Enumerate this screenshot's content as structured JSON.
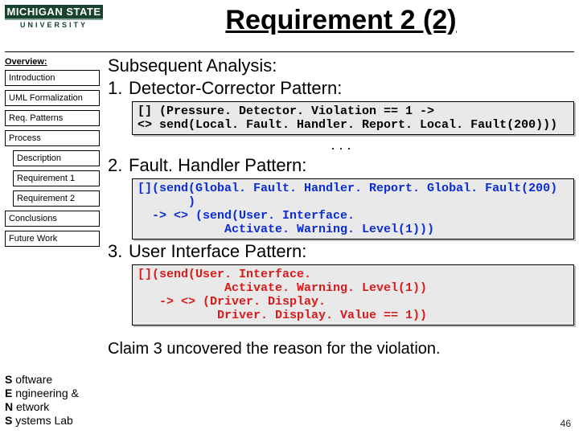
{
  "logo": {
    "top": "MICHIGAN STATE",
    "bottom": "UNIVERSITY"
  },
  "title": "Requirement 2 (2)",
  "sidebar": {
    "heading": "Overview:",
    "items": [
      "Introduction",
      "UML Formalization",
      "Req. Patterns",
      "Process"
    ],
    "sub_items": [
      "Description",
      "Requirement 1",
      "Requirement 2"
    ],
    "items2": [
      "Conclusions",
      "Future Work"
    ]
  },
  "lab_lines": [
    "S oftware",
    "E ngineering &",
    "N etwork",
    "S ystems Lab"
  ],
  "content": {
    "lead": "Subsequent Analysis:",
    "p1": {
      "num": "1.",
      "label": "Detector-Corrector Pattern:",
      "code": "[] (Pressure. Detector. Violation == 1 ->\n<> send(Local. Fault. Handler. Report. Local. Fault(200)))"
    },
    "dots": ". . .",
    "p2": {
      "num": "2.",
      "label": "Fault. Handler Pattern:",
      "code": "[](send(Global. Fault. Handler. Report. Global. Fault(200)\n       )\n  -> <> (send(User. Interface.\n            Activate. Warning. Level(1)))"
    },
    "p3": {
      "num": "3.",
      "label": "User Interface Pattern:",
      "code": "[](send(User. Interface.\n            Activate. Warning. Level(1))\n   -> <> (Driver. Display.\n           Driver. Display. Value == 1))"
    },
    "claim": "Claim 3 uncovered the reason for the violation."
  },
  "page_number": "46"
}
